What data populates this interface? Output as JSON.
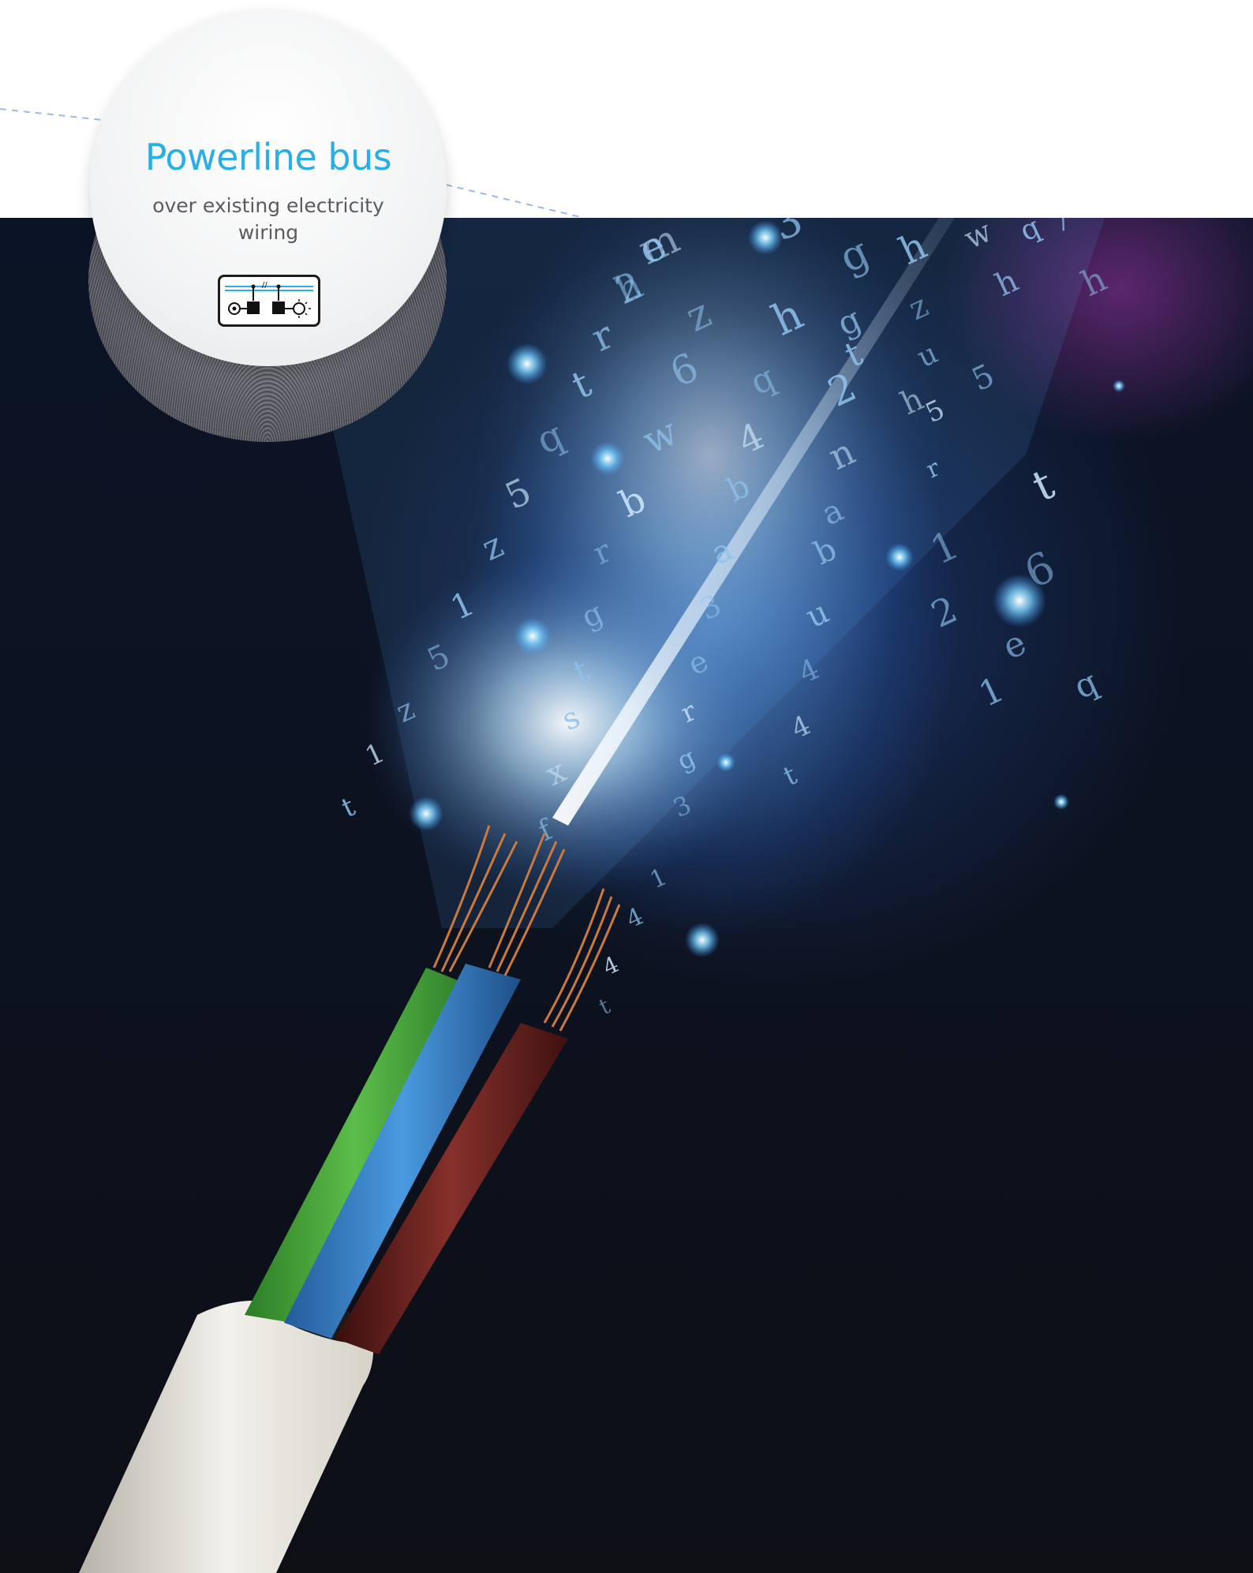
{
  "badge": {
    "title": "Powerline bus",
    "subtitle": "over existing electricity wiring",
    "icon": "powerline-circuit-icon"
  },
  "colors": {
    "title": "#2aaee4",
    "subtitle": "#5b5b5f",
    "dash_line": "#9fb9e0",
    "background_dark": "#0c1220",
    "wire_green": "#4caa3c",
    "wire_blue": "#3f86c9",
    "wire_brown": "#6b1f1c",
    "sheath": "#eae7df"
  },
  "photo": {
    "subject": "electric-cable-with-glowing-characters",
    "glyphs": [
      "m",
      "2",
      "r",
      "t",
      "q",
      "5",
      "z",
      "1",
      "5",
      "z",
      "1",
      "t",
      "z",
      "6",
      "w",
      "b",
      "r",
      "g",
      "t",
      "s",
      "x",
      "f",
      "3",
      "h",
      "q",
      "4",
      "b",
      "a",
      "3",
      "e",
      "r",
      "g",
      "3",
      "1",
      "4",
      "4",
      "t",
      "g",
      "g",
      "2",
      "n",
      "a",
      "b",
      "u",
      "4",
      "4",
      "t",
      "h",
      "z",
      "u",
      "5",
      "r",
      "1",
      "2",
      "1",
      "t",
      "6",
      "e",
      "q",
      "t",
      "h",
      "5",
      "h",
      "q",
      "h",
      "w",
      "7",
      "e",
      "h"
    ]
  }
}
